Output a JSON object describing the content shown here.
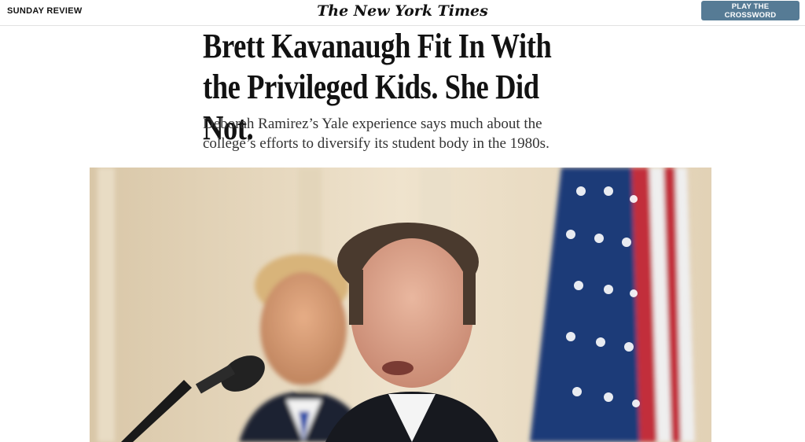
{
  "header": {
    "section": "SUNDAY REVIEW",
    "logo": "The New York Times",
    "crossword_button": "PLAY THE CROSSWORD"
  },
  "article": {
    "headline": "Brett Kavanaugh Fit In With the Privileged Kids. She Did Not.",
    "summary": "Deborah Ramirez’s Yale experience says much about the college’s efforts to diversify its student body in the 1980s."
  },
  "colors": {
    "crossword_button": "#567b95",
    "text": "#121212",
    "summary_text": "#333333"
  }
}
